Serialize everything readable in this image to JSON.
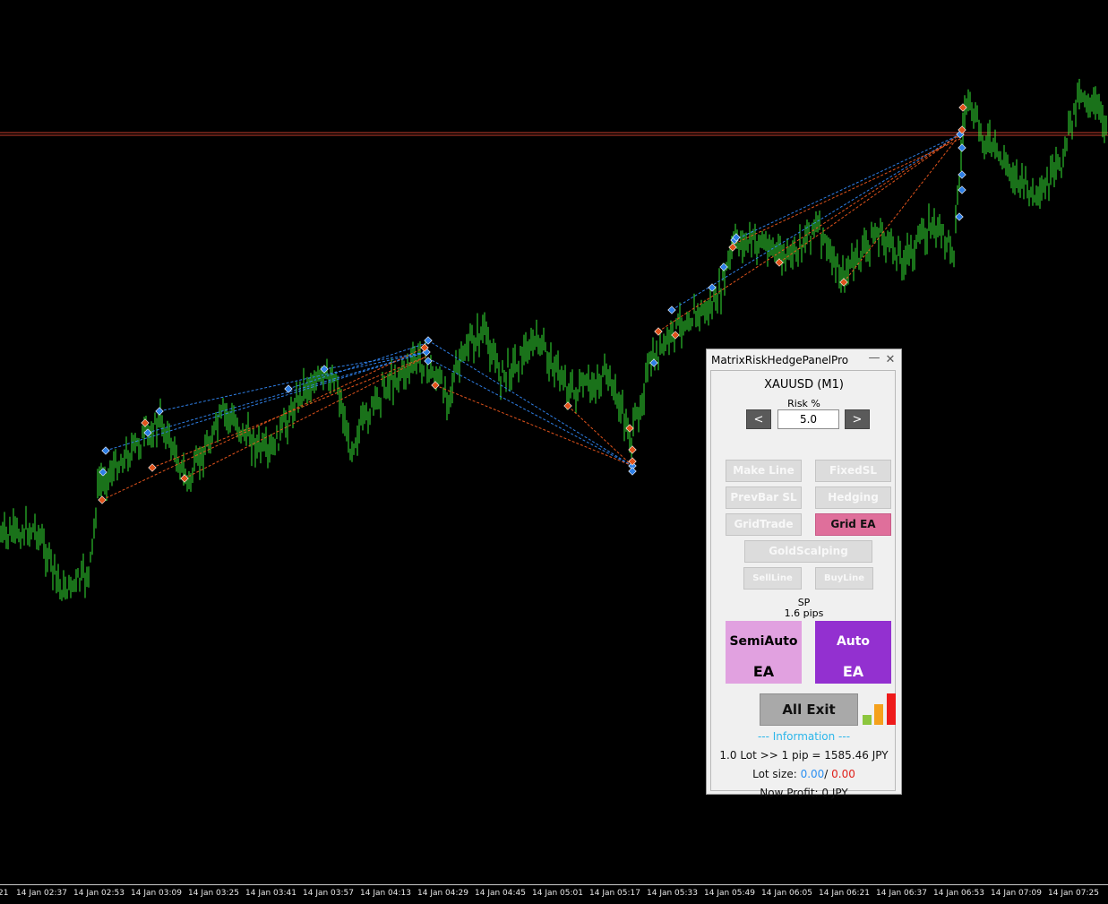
{
  "chart": {
    "background": "#000000",
    "candle_color": "#33e533",
    "hline_color": "#c23b2c",
    "time_labels": [
      "21",
      "14 Jan 02:37",
      "14 Jan 02:53",
      "14 Jan 03:09",
      "14 Jan 03:25",
      "14 Jan 03:41",
      "14 Jan 03:57",
      "14 Jan 04:13",
      "14 Jan 04:29",
      "14 Jan 04:45",
      "14 Jan 05:01",
      "14 Jan 05:17",
      "14 Jan 05:33",
      "14 Jan 05:49",
      "14 Jan 06:05",
      "14 Jan 06:21",
      "14 Jan 06:37",
      "14 Jan 06:53",
      "14 Jan 07:09",
      "14 Jan 07:25"
    ]
  },
  "panel": {
    "title": "MatrixRiskHedgePanelPro",
    "minimize_icon": "minimize-icon",
    "close_icon": "close-icon",
    "symbol": "XAUUSD (M1)",
    "risk_label": "Risk %",
    "risk_value": "5.0",
    "dec_label": "<",
    "inc_label": ">",
    "buttons": {
      "make_line": "Make Line",
      "fixed_sl": "FixedSL",
      "prevbar_sl": "PrevBar SL",
      "hedging": "Hedging",
      "grid_trade": "GridTrade",
      "grid_ea": "Grid EA",
      "gold_scalping": "GoldScalping",
      "sell_line": "SellLine",
      "buy_line": "BuyLine"
    },
    "sp_label": "SP",
    "sp_value": "1.6 pips",
    "semiauto": {
      "line1": "SemiAuto",
      "line2": "EA",
      "color": "#e1a1e0"
    },
    "auto": {
      "line1": "Auto",
      "line2": "EA",
      "color": "#9330d0"
    },
    "all_exit": "All Exit",
    "signal_icon": "signal-bars-icon",
    "info_heading": "--- Information ---",
    "pip_value_line": "1.0 Lot >> 1 pip = 1585.46 JPY",
    "lot_size_label": "Lot size:",
    "lot_buy": "0.00",
    "lot_sep": "/",
    "lot_sell": "0.00",
    "profit_label": "Now Profit:",
    "profit_value": "0 JPY"
  }
}
